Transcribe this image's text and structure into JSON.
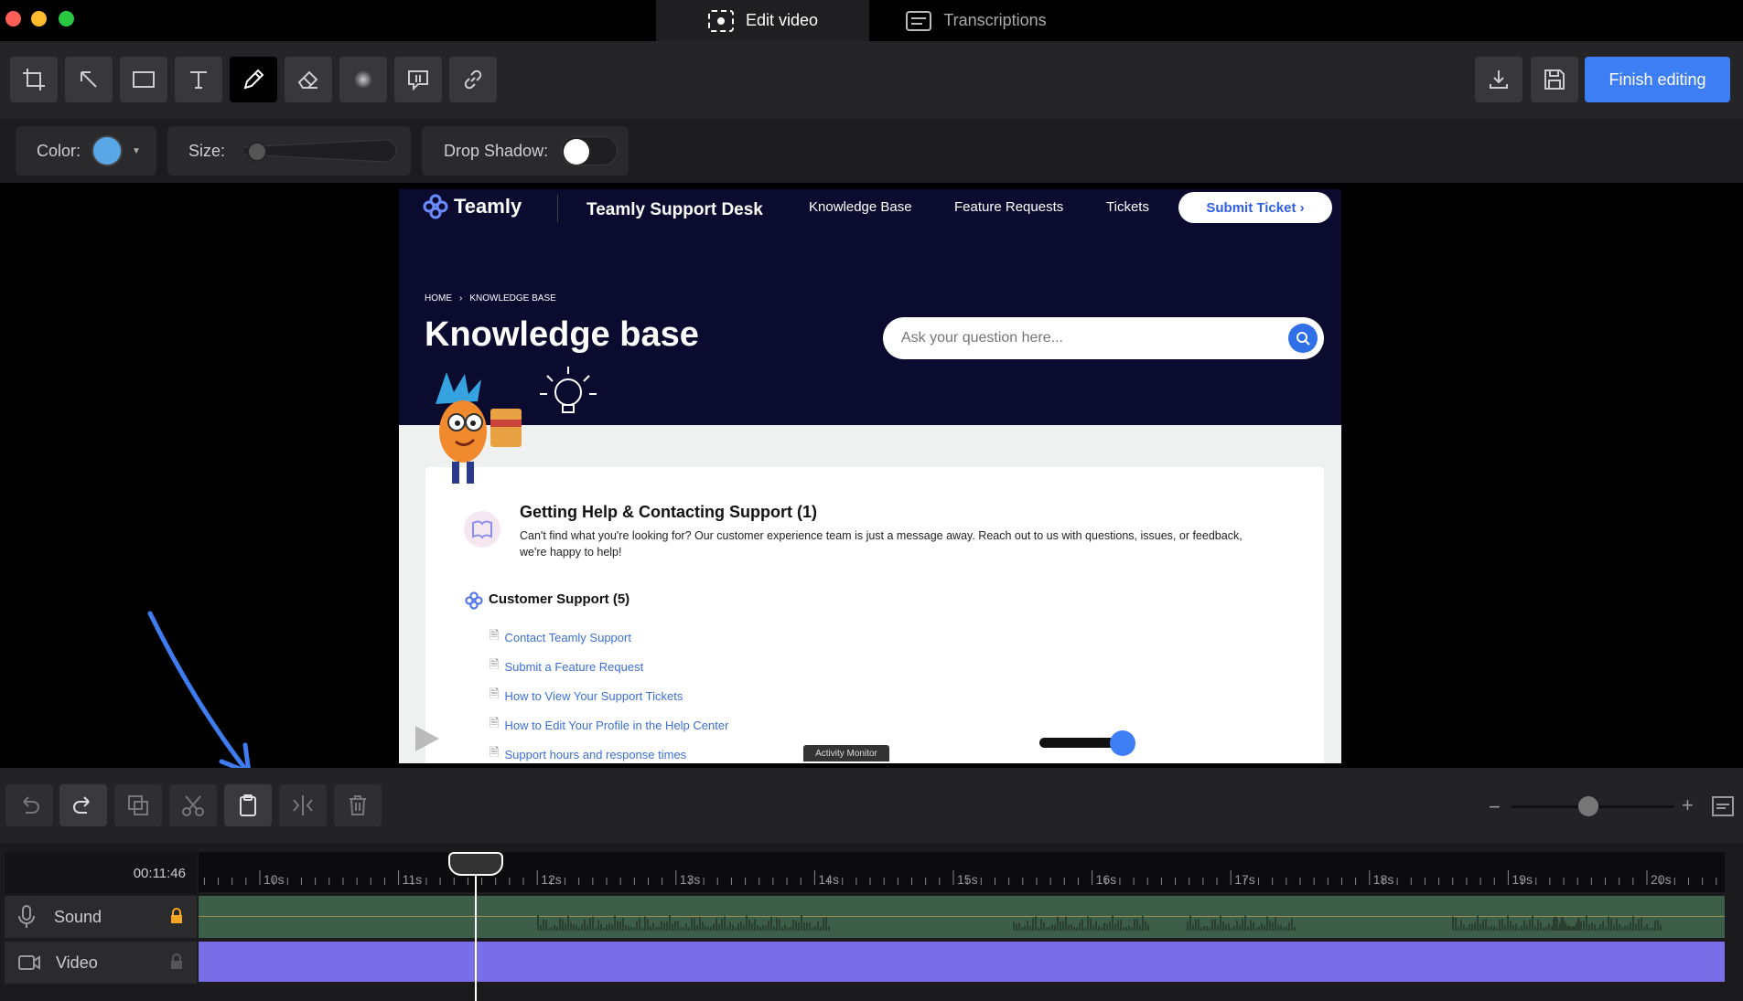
{
  "titlebar": {
    "tabs": [
      {
        "label": "Edit video",
        "icon": "screen-record-icon",
        "active": true
      },
      {
        "label": "Transcriptions",
        "icon": "transcript-icon",
        "active": false
      }
    ]
  },
  "toolbar": {
    "tools": [
      "crop-icon",
      "arrow-icon",
      "rectangle-icon",
      "text-icon",
      "pen-icon",
      "eraser-icon",
      "blur-icon",
      "step-marker-icon",
      "link-icon"
    ],
    "active_tool": "pen-icon",
    "finish_label": "Finish editing"
  },
  "options": {
    "color_label": "Color:",
    "color_value": "#5aa7e8",
    "size_label": "Size:",
    "size_value": 0,
    "shadow_label": "Drop Shadow:",
    "shadow_on": false
  },
  "site": {
    "logo": "Teamly",
    "title": "Teamly Support Desk",
    "nav": [
      "Knowledge Base",
      "Feature Requests",
      "Tickets"
    ],
    "cta": "Submit Ticket ›",
    "breadcrumb": [
      "HOME",
      "KNOWLEDGE BASE"
    ],
    "heading": "Knowledge base",
    "search_placeholder": "Ask your question here...",
    "section1_title": "Getting Help & Contacting Support (1)",
    "section1_desc": "Can't find what you're looking for? Our customer experience team is just a message away. Reach out to us with questions, issues, or feedback, we're happy to help!",
    "section2_title": "Customer Support (5)",
    "articles": [
      "Contact Teamly Support",
      "Submit a Feature Request",
      "How to View Your Support Tickets",
      "How to Edit Your Profile in the Help Center",
      "Support hours and response times"
    ],
    "tooltip": "Activity Monitor"
  },
  "timeline": {
    "timecode": "00:11:46",
    "ticks": [
      "10s",
      "11s",
      "12s",
      "13s",
      "14s",
      "15s",
      "16s",
      "17s",
      "18s",
      "19s",
      "20s"
    ],
    "tracks": [
      {
        "label": "Sound",
        "icon": "microphone-icon",
        "locked": true
      },
      {
        "label": "Video",
        "icon": "video-camera-icon",
        "locked": false
      }
    ]
  },
  "colors": {
    "accent": "#3d7ef5",
    "video_track": "#7a6ee8",
    "sound_track": "#3d5e48",
    "annotation_arrow": "#3f7cf0"
  }
}
